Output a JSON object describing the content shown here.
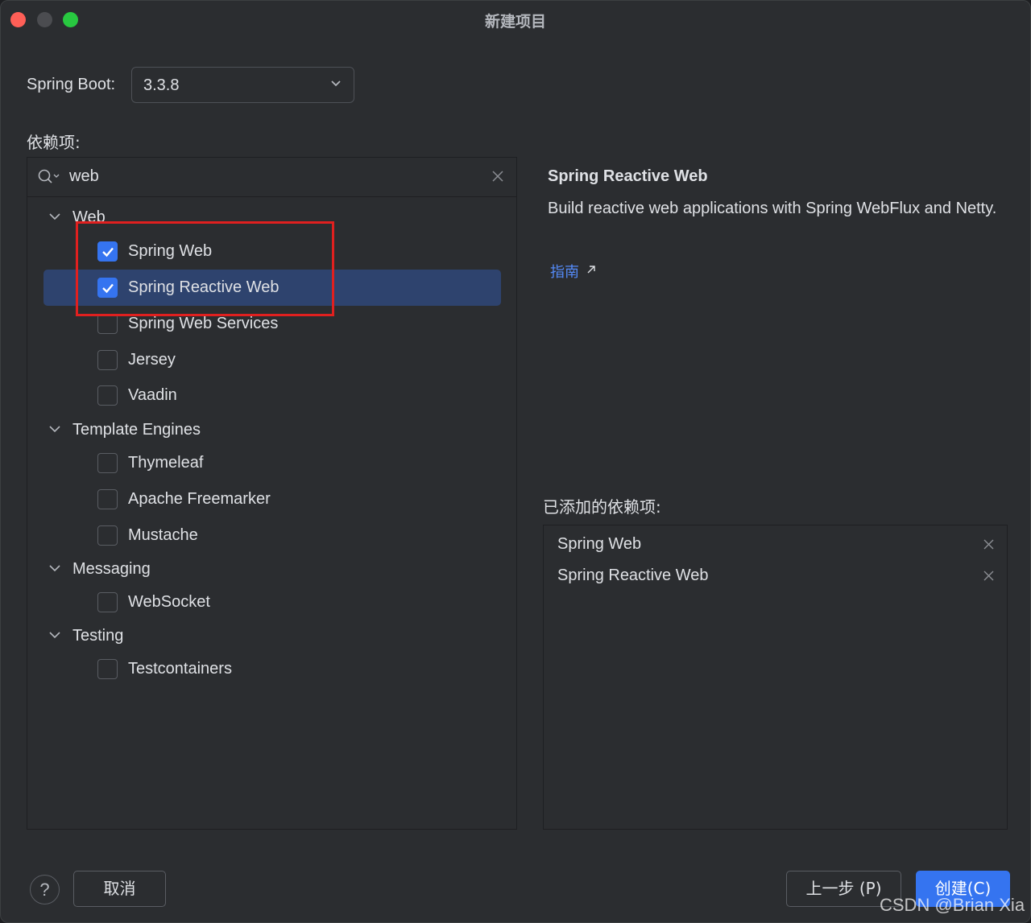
{
  "window": {
    "title": "新建项目"
  },
  "spring_boot": {
    "label": "Spring Boot:",
    "value": "3.3.8"
  },
  "dependencies": {
    "label": "依赖项:",
    "search_value": "web",
    "groups": [
      {
        "label": "Web",
        "items": [
          {
            "label": "Spring Web",
            "checked": true
          },
          {
            "label": "Spring Reactive Web",
            "checked": true,
            "selected": true
          },
          {
            "label": "Spring Web Services",
            "checked": false
          },
          {
            "label": "Jersey",
            "checked": false
          },
          {
            "label": "Vaadin",
            "checked": false
          }
        ]
      },
      {
        "label": "Template Engines",
        "items": [
          {
            "label": "Thymeleaf",
            "checked": false
          },
          {
            "label": "Apache Freemarker",
            "checked": false
          },
          {
            "label": "Mustache",
            "checked": false
          }
        ]
      },
      {
        "label": "Messaging",
        "items": [
          {
            "label": "WebSocket",
            "checked": false
          }
        ]
      },
      {
        "label": "Testing",
        "items": [
          {
            "label": "Testcontainers",
            "checked": false
          }
        ]
      }
    ]
  },
  "info": {
    "title": "Spring Reactive Web",
    "description": "Build reactive web applications with Spring WebFlux and Netty.",
    "guide_link": "指南"
  },
  "added": {
    "label": "已添加的依赖项:",
    "items": [
      "Spring Web",
      "Spring Reactive Web"
    ]
  },
  "footer": {
    "help": "?",
    "cancel": "取消",
    "previous": "上一步 (P)",
    "create": "创建(C)"
  },
  "watermark": "CSDN @Brian Xia",
  "colors": {
    "accent": "#3574f0",
    "highlight_box": "#e0201f",
    "selected_row": "#2e436e"
  }
}
